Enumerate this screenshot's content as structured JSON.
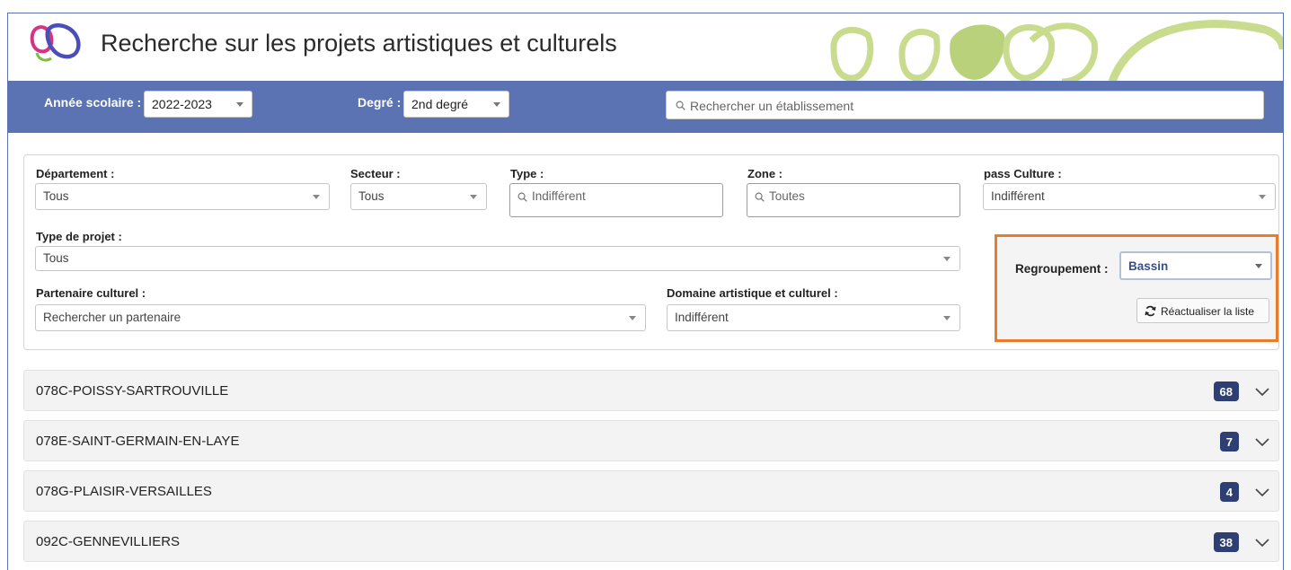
{
  "header": {
    "title": "Recherche sur les projets artistiques et culturels"
  },
  "topbar": {
    "year_label": "Année scolaire :",
    "year_value": "2022-2023",
    "degree_label": "Degré :",
    "degree_value": "2nd degré",
    "search_placeholder": "Rechercher un établissement"
  },
  "filters": {
    "departement": {
      "label": "Département :",
      "value": "Tous"
    },
    "secteur": {
      "label": "Secteur :",
      "value": "Tous"
    },
    "type": {
      "label": "Type :",
      "placeholder": "Indifférent"
    },
    "zone": {
      "label": "Zone :",
      "placeholder": "Toutes"
    },
    "pass_culture": {
      "label": "pass Culture :",
      "value": "Indifférent"
    },
    "type_projet": {
      "label": "Type de projet :",
      "value": "Tous"
    },
    "partenaire": {
      "label": "Partenaire culturel :",
      "placeholder": "Rechercher un partenaire"
    },
    "domaine": {
      "label": "Domaine artistique et culturel :",
      "value": "Indifférent"
    }
  },
  "regroupement": {
    "label": "Regroupement :",
    "value": "Bassin",
    "refresh_label": "Réactualiser la liste"
  },
  "groups": [
    {
      "name": "078C-POISSY-SARTROUVILLE",
      "count": "68"
    },
    {
      "name": "078E-SAINT-GERMAIN-EN-LAYE",
      "count": "7"
    },
    {
      "name": "078G-PLAISIR-VERSAILLES",
      "count": "4"
    },
    {
      "name": "092C-GENNEVILLIERS",
      "count": "38"
    }
  ],
  "colors": {
    "topbar": "#5b73b3",
    "badge": "#2f3f73",
    "highlight": "#e97b2c",
    "deco_green": "#c9dc8e"
  }
}
